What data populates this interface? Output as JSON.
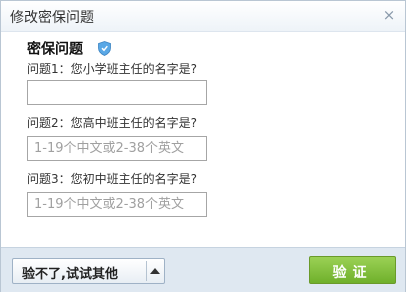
{
  "dialog": {
    "title": "修改密保问题",
    "close_glyph": "×"
  },
  "section": {
    "title": "密保问题",
    "icon": "shield-icon"
  },
  "questions": [
    {
      "label": "问题1：您小学班主任的名字是?",
      "value": "",
      "placeholder": ""
    },
    {
      "label": "问题2：您高中班主任的名字是?",
      "value": "",
      "placeholder": "1-19个中文或2-38个英文"
    },
    {
      "label": "问题3：您初中班主任的名字是?",
      "value": "",
      "placeholder": "1-19个中文或2-38个英文"
    }
  ],
  "footer": {
    "alt_label": "验不了,试试其他",
    "verify_label": "验证"
  },
  "colors": {
    "verify_green": "#7dbd35",
    "footer_bg": "#dfe8f1",
    "shield_blue": "#5aa8e6"
  }
}
